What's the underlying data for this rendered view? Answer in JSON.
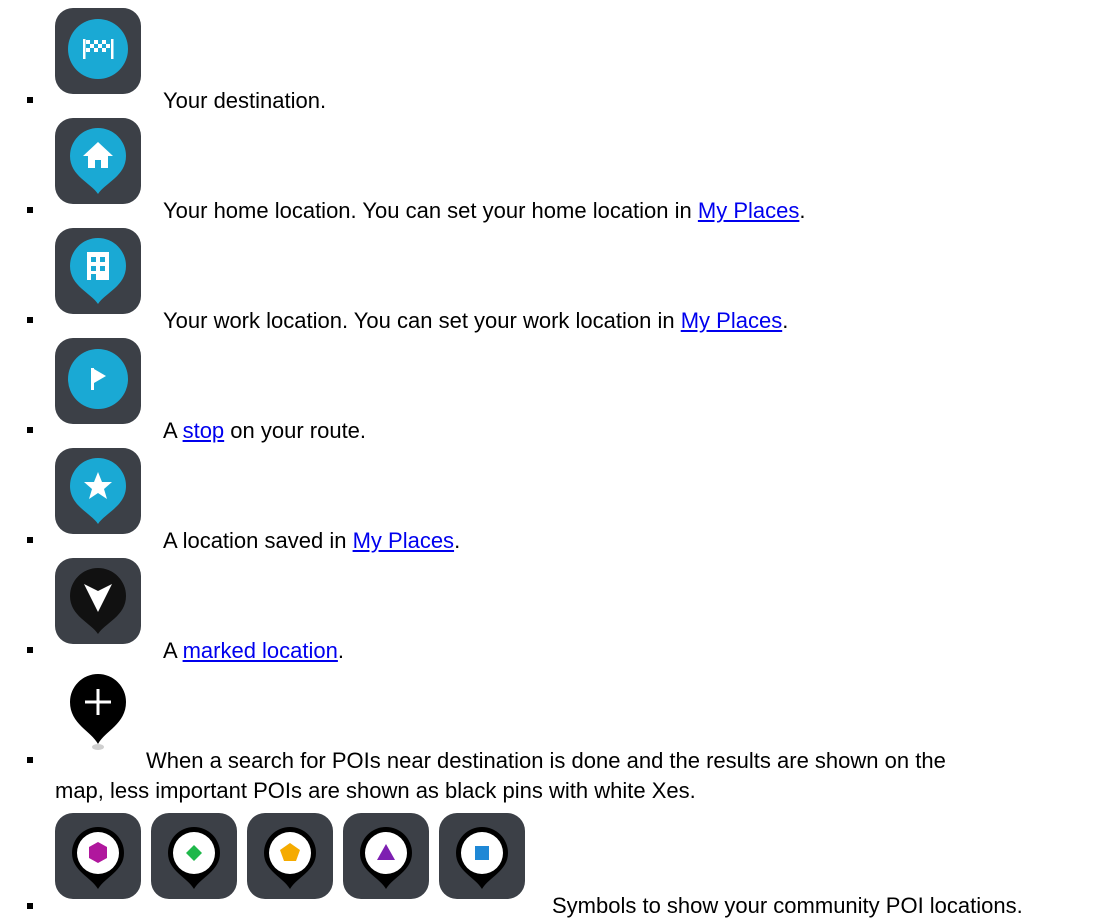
{
  "items": [
    {
      "icon": "destination-flag-icon",
      "parts": {
        "pre": "Your destination.",
        "link": "",
        "post": ""
      }
    },
    {
      "icon": "home-pin-icon",
      "parts": {
        "pre": "Your home location. You can set your home location in ",
        "link": "My Places",
        "post": "."
      }
    },
    {
      "icon": "work-pin-icon",
      "parts": {
        "pre": "Your work location. You can set your work location in ",
        "link": "My Places",
        "post": "."
      }
    },
    {
      "icon": "stop-flag-icon",
      "parts": {
        "pre": "A ",
        "link": "stop",
        "post": " on your route."
      }
    },
    {
      "icon": "saved-star-pin-icon",
      "parts": {
        "pre": "A location saved in ",
        "link": "My Places",
        "post": "."
      }
    },
    {
      "icon": "marked-location-pin-icon",
      "parts": {
        "pre": "A ",
        "link": "marked location",
        "post": "."
      }
    },
    {
      "icon": "poi-plus-pin-icon",
      "line1": "When a search for POIs near destination is done and the results are shown on the",
      "line2": "map, less important POIs are shown as black pins with white Xes."
    },
    {
      "icon": "community-poi-pins-icon",
      "text": "Symbols to show your community POI locations."
    }
  ],
  "colors": {
    "tile": "#3c4047",
    "teal": "#1aa9d4",
    "dark_pin": "#111111",
    "hexagon": "#b0179d",
    "diamond": "#1fb84a",
    "pentagon": "#f5ab00",
    "triangle": "#7d1fb1",
    "square": "#1f88d6"
  }
}
